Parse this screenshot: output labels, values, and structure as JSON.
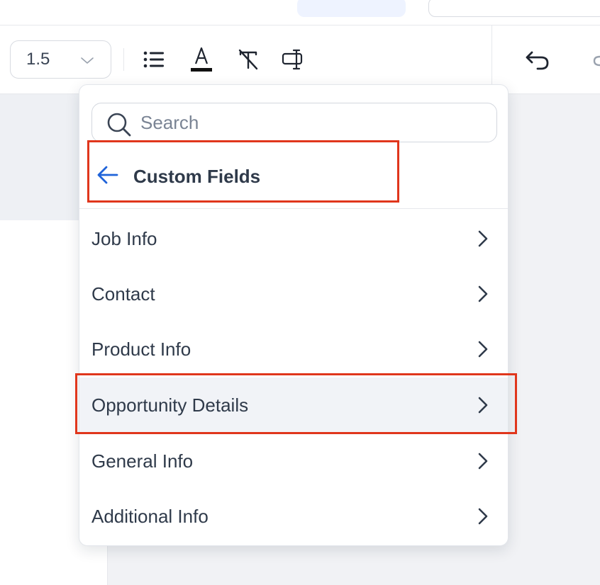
{
  "toolbar": {
    "line_height": "1.5",
    "icons": [
      "list-icon",
      "text-color-icon",
      "clear-format-icon",
      "text-field-icon",
      "undo-icon"
    ]
  },
  "dropdown": {
    "search": {
      "placeholder": "Search",
      "value": ""
    },
    "header": {
      "title": "Custom Fields"
    },
    "items": [
      {
        "label": "Job Info"
      },
      {
        "label": "Contact"
      },
      {
        "label": "Product Info"
      },
      {
        "label": "Opportunity Details",
        "highlighted": true
      },
      {
        "label": "General Info"
      },
      {
        "label": "Additional Info"
      }
    ]
  },
  "colors": {
    "accent_blue": "#1f63d9",
    "highlight_red": "#e0361c",
    "hover_bg": "#f1f3f7",
    "text": "#2f3a4a"
  }
}
